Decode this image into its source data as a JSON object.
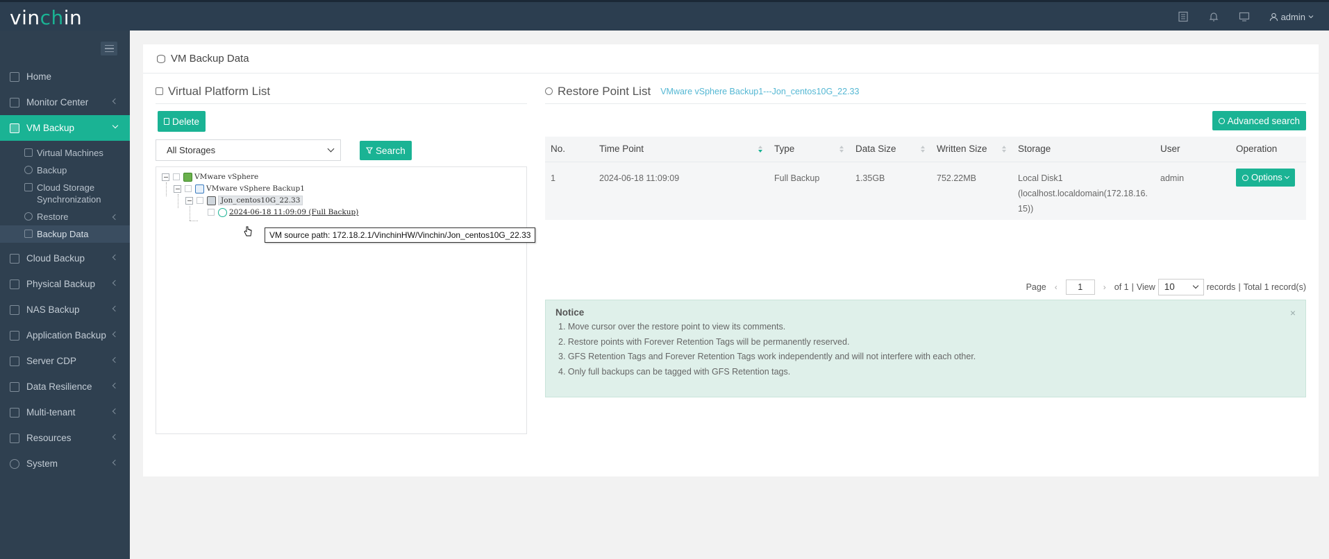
{
  "app": {
    "logo_prefix": "vin",
    "logo_accent": "ch",
    "logo_suffix": "in",
    "user": "admin",
    "accent_color": "#1ab394",
    "header_bg": "#2c3e50",
    "sidebar_bg": "#2f4050"
  },
  "header": {
    "icons": [
      "list-icon",
      "bell-icon",
      "monitor-icon",
      "user-icon"
    ]
  },
  "sidebar": {
    "items": [
      {
        "label": "Home",
        "icon": "home-icon",
        "has_children": false
      },
      {
        "label": "Monitor Center",
        "icon": "monitor-icon",
        "has_children": true
      },
      {
        "label": "VM Backup",
        "icon": "vm-icon",
        "has_children": true,
        "active": true,
        "children": [
          {
            "label": "Virtual Machines"
          },
          {
            "label": "Backup"
          },
          {
            "label": "Cloud Storage Synchronization"
          },
          {
            "label": "Restore",
            "has_children": true
          },
          {
            "label": "Backup Data",
            "current": true
          }
        ]
      },
      {
        "label": "Cloud Backup",
        "icon": "cloud-icon",
        "has_children": true
      },
      {
        "label": "Physical Backup",
        "icon": "server-icon",
        "has_children": true
      },
      {
        "label": "NAS Backup",
        "icon": "nas-icon",
        "has_children": true
      },
      {
        "label": "Application Backup",
        "icon": "app-icon",
        "has_children": true
      },
      {
        "label": "Server CDP",
        "icon": "cdp-icon",
        "has_children": true
      },
      {
        "label": "Data Resilience",
        "icon": "resilience-icon",
        "has_children": true
      },
      {
        "label": "Multi-tenant",
        "icon": "tenant-icon",
        "has_children": true
      },
      {
        "label": "Resources",
        "icon": "resources-icon",
        "has_children": true
      },
      {
        "label": "System",
        "icon": "gear-icon",
        "has_children": true
      }
    ]
  },
  "page": {
    "title": "VM Backup Data"
  },
  "platform": {
    "title": "Virtual Platform List",
    "delete_label": "Delete",
    "storage_selected": "All Storages",
    "search_label": "Search",
    "tree": {
      "root": "VMware vSphere",
      "backup": "VMware vSphere Backup1",
      "vm": "Jon_centos10G_22.33",
      "point": "2024-06-18 11:09:09 (Full Backup)"
    },
    "tooltip": "VM source path: 172.18.2.1/VinchinHW/Vinchin/Jon_centos10G_22.33"
  },
  "restore": {
    "title": "Restore Point List",
    "subtitle": "VMware vSphere Backup1---Jon_centos10G_22.33",
    "advanced_label": "Advanced search",
    "columns": [
      "No.",
      "Time Point",
      "Type",
      "Data Size",
      "Written Size",
      "Storage",
      "User",
      "Operation"
    ],
    "rows": [
      {
        "no": "1",
        "time": "2024-06-18 11:09:09",
        "type": "Full Backup",
        "data_size": "1.35GB",
        "written_size": "752.22MB",
        "storage_line1": "Local Disk1",
        "storage_line2": "(localhost.localdomain(172.18.16.",
        "storage_line3": "15))",
        "user": "admin",
        "operation": "Options"
      }
    ],
    "pager": {
      "page_label": "Page",
      "page": "1",
      "of_label": "of 1",
      "sep": "|",
      "view_label": "View",
      "per_page": "10",
      "records_label": "records",
      "total_label": "Total 1 record(s)"
    },
    "notice": {
      "title": "Notice",
      "items": [
        "1. Move cursor over the restore point to view its comments.",
        "2. Restore points with Forever Retention Tags will be permanently reserved.",
        "3. GFS Retention Tags and Forever Retention Tags work independently and will not interfere with each other.",
        "4. Only full backups can be tagged with GFS Retention tags."
      ]
    }
  }
}
